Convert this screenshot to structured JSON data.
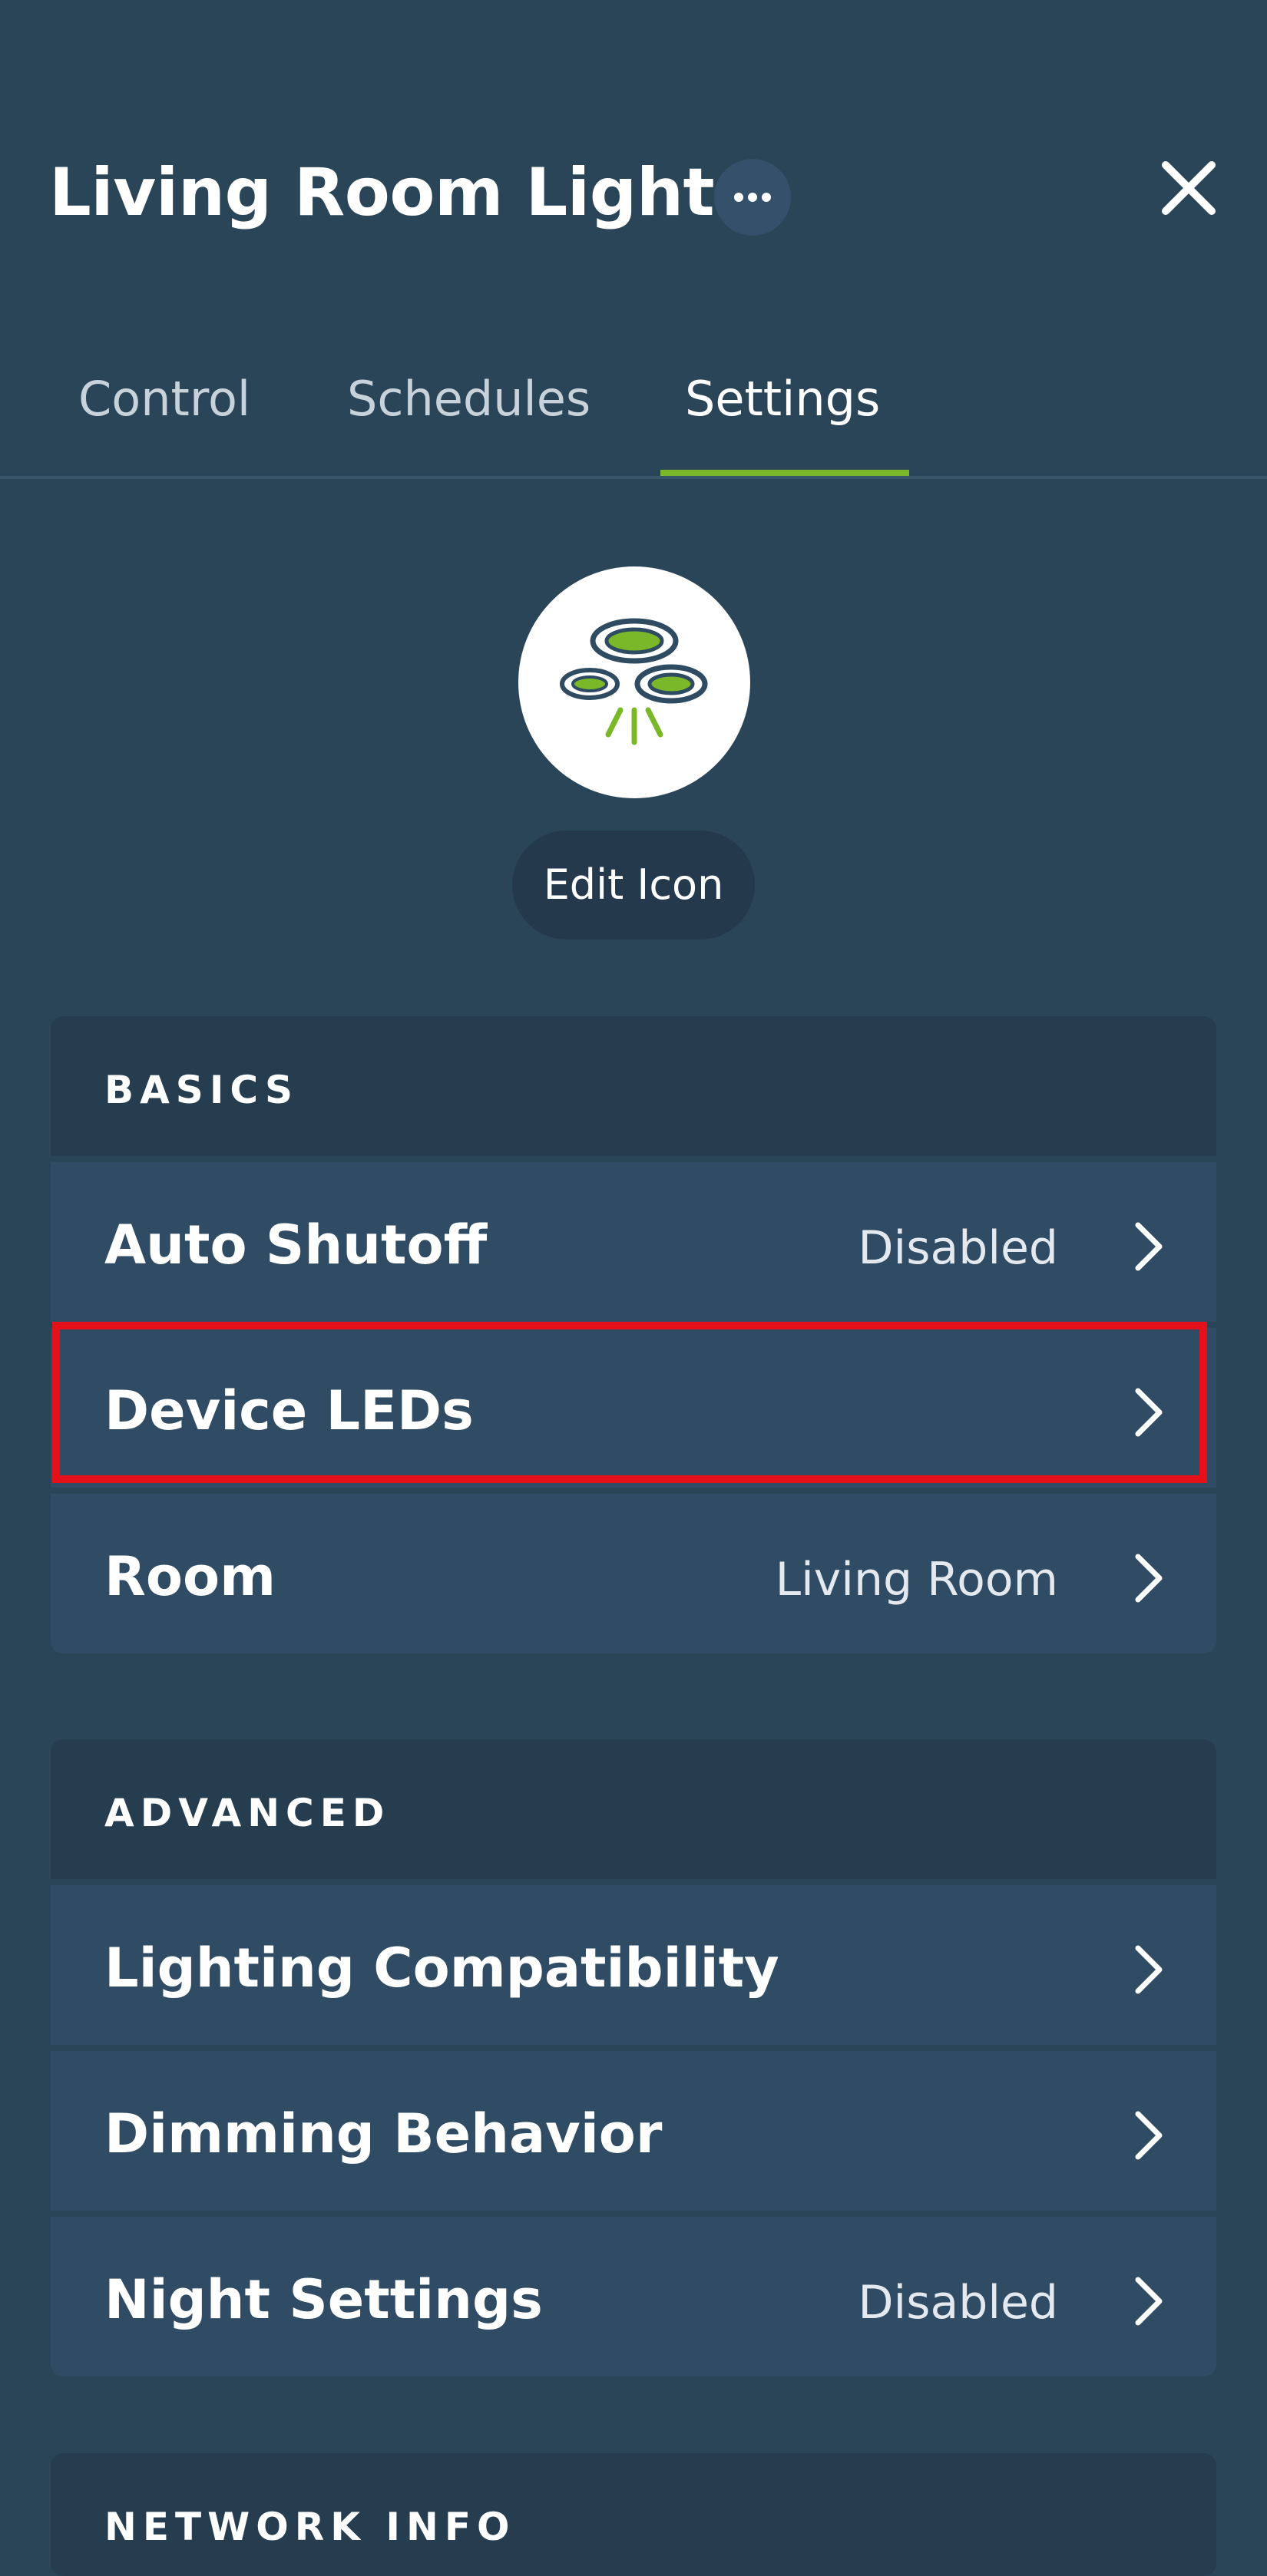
{
  "header": {
    "title": "Living Room Lights",
    "more_icon": "ellipsis-icon",
    "close_icon": "close-icon"
  },
  "tabs": [
    {
      "label": "Control",
      "active": false
    },
    {
      "label": "Schedules",
      "active": false
    },
    {
      "label": "Settings",
      "active": true
    }
  ],
  "device": {
    "icon": "ceiling-lights-icon",
    "edit_label": "Edit Icon"
  },
  "sections": {
    "basics": {
      "title": "BASICS",
      "rows": [
        {
          "label": "Auto Shutoff",
          "value": "Disabled"
        },
        {
          "label": "Device LEDs",
          "value": ""
        },
        {
          "label": "Room",
          "value": "Living Room"
        }
      ]
    },
    "advanced": {
      "title": "ADVANCED",
      "rows": [
        {
          "label": "Lighting Compatibility",
          "value": ""
        },
        {
          "label": "Dimming Behavior",
          "value": ""
        },
        {
          "label": "Night Settings",
          "value": "Disabled"
        }
      ]
    },
    "network": {
      "title": "NETWORK INFO"
    }
  },
  "colors": {
    "background": "#2b4558",
    "accent": "#7ab82a",
    "highlight": "#e4101a"
  }
}
